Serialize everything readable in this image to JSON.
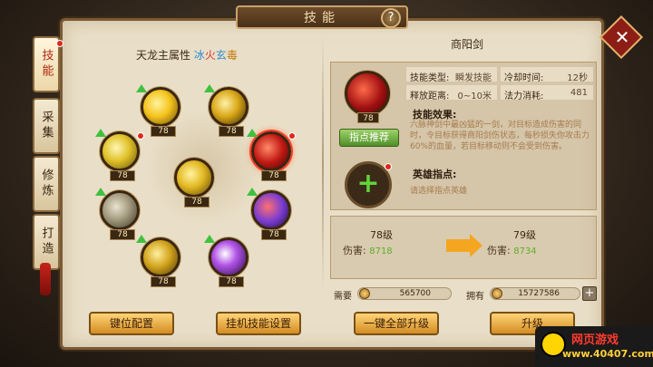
{
  "window": {
    "title": "技能"
  },
  "side_tabs": [
    {
      "label": "技能",
      "active": true,
      "badge": true
    },
    {
      "label": "采集",
      "active": false,
      "badge": false
    },
    {
      "label": "修炼",
      "active": false,
      "badge": false
    },
    {
      "label": "打造",
      "active": false,
      "badge": false
    }
  ],
  "attribute": {
    "label": "天龙主属性",
    "elem1": "冰",
    "elem2": "火",
    "elem3": "玄",
    "elem4": "毒"
  },
  "skills": [
    {
      "level": "78",
      "upgradable": true,
      "selected": false,
      "color": "#f5c41d"
    },
    {
      "level": "78",
      "upgradable": true,
      "selected": false,
      "color": "#d9a717"
    },
    {
      "level": "78",
      "upgradable": true,
      "selected": false,
      "color": "#e0c229"
    },
    {
      "level": "78",
      "upgradable": true,
      "selected": true,
      "color": "#c21a14"
    },
    {
      "level": "78",
      "upgradable": false,
      "selected": false,
      "color": "#e3b822"
    },
    {
      "level": "78",
      "upgradable": true,
      "selected": false,
      "color": "#a39a7e"
    },
    {
      "level": "78",
      "upgradable": true,
      "selected": false,
      "color": "#7c3dd1"
    },
    {
      "level": "78",
      "upgradable": true,
      "selected": false,
      "color": "#d2a31c"
    },
    {
      "level": "78",
      "upgradable": true,
      "selected": false,
      "color": "#b254e6"
    }
  ],
  "detail": {
    "name": "商阳剑",
    "icon_level": "78",
    "recommend_button": "指点推荐",
    "type_label": "技能类型:",
    "type_value": "瞬发技能",
    "cooldown_label": "冷却时间:",
    "cooldown_value": "12秒",
    "range_label": "释放距离:",
    "range_value": "0~10米",
    "mana_label": "法力消耗:",
    "mana_value": "481",
    "effect_title": "技能效果:",
    "effect_text": "六脉神剑中最凶猛的一剑，对目标造成伤害的同时，令目标获得商阳剑伤状态，每秒损失你攻击力60%的血量，若目标移动则不会受到伤害。",
    "hero_title": "英雄指点:",
    "hero_text": "请选择指点英雄"
  },
  "compare": {
    "current_level": "78级",
    "current_damage_label": "伤害:",
    "current_damage": "8718",
    "next_level": "79级",
    "next_damage_label": "伤害:",
    "next_damage": "8734"
  },
  "cost": {
    "need_label": "需要",
    "need_value": "565700",
    "have_label": "拥有",
    "have_value": "15727586"
  },
  "buttons": {
    "keybind": "键位配置",
    "auto_skill": "挂机技能设置",
    "upgrade_all": "一键全部升级",
    "upgrade": "升级"
  },
  "watermark": {
    "text": "网页游戏",
    "url": "www.40407.com"
  }
}
